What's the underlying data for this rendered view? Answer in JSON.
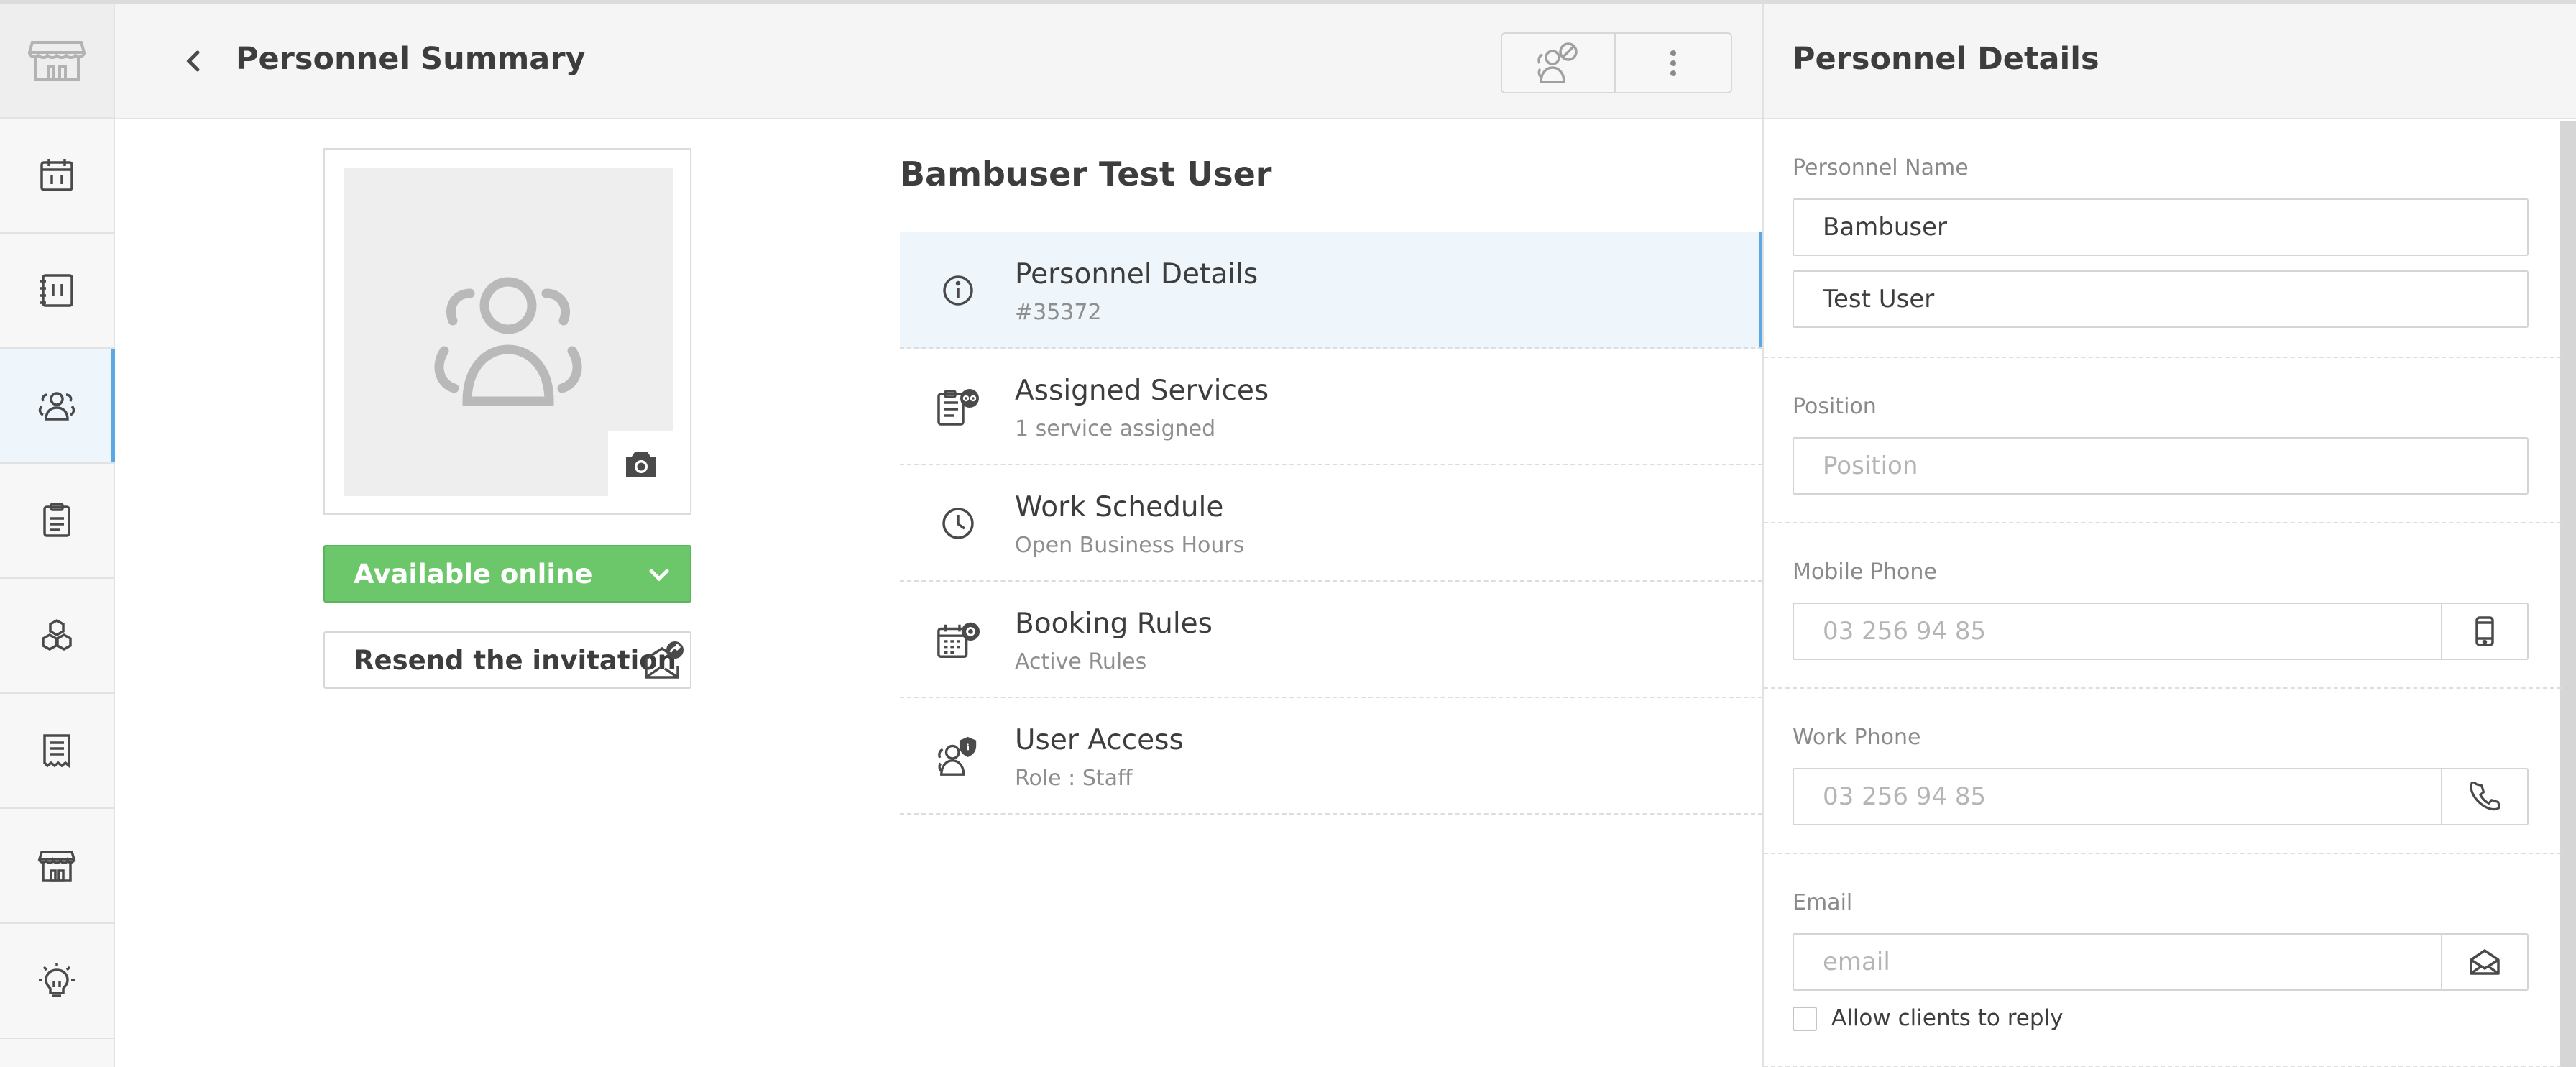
{
  "header": {
    "title": "Personnel Summary"
  },
  "nav": {
    "items": [
      "store-logo-icon",
      "calendar-icon",
      "planner-icon",
      "personnel-icon",
      "clipboard-icon",
      "services-icon",
      "receipt-icon",
      "shop-icon",
      "lightbulb-icon"
    ],
    "active": "personnel-icon",
    "accent": "#5aa9e6"
  },
  "profile": {
    "availability_label": "Available online",
    "availability_color": "#6cc66a",
    "resend_label": "Resend the invitation"
  },
  "user": {
    "name": "Bambuser Test User"
  },
  "menu": [
    {
      "icon": "info-icon",
      "title": "Personnel Details",
      "subtitle": "#35372"
    },
    {
      "icon": "assigned-services-icon",
      "title": "Assigned Services",
      "subtitle": "1 service assigned"
    },
    {
      "icon": "clock-icon",
      "title": "Work Schedule",
      "subtitle": "Open Business Hours"
    },
    {
      "icon": "booking-rules-icon",
      "title": "Booking Rules",
      "subtitle": "Active Rules"
    },
    {
      "icon": "user-access-icon",
      "title": "User Access",
      "subtitle": "Role : Staff"
    }
  ],
  "details": {
    "title": "Personnel Details",
    "name_label": "Personnel Name",
    "first_name": "Bambuser",
    "last_name": "Test User",
    "position_label": "Position",
    "position_placeholder": "Position",
    "mobile_label": "Mobile Phone",
    "mobile_placeholder": "03 256 94 85",
    "work_label": "Work Phone",
    "work_placeholder": "03 256 94 85",
    "email_label": "Email",
    "email_placeholder": "email",
    "allow_reply_label": "Allow clients to reply"
  }
}
